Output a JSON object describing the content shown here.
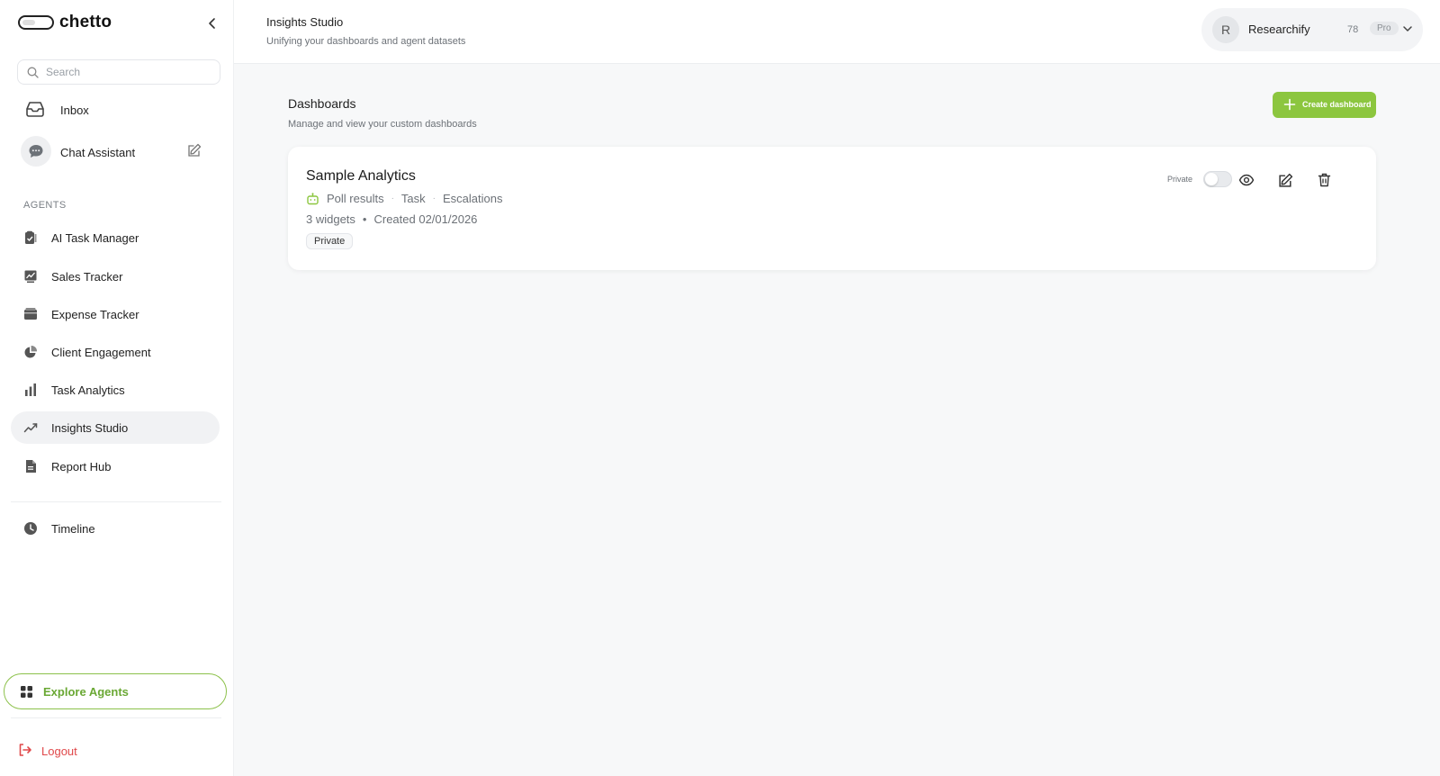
{
  "app": {
    "name": "chetto"
  },
  "sidebar": {
    "search_placeholder": "Search",
    "inbox_label": "Inbox",
    "chat_label": "Chat Assistant",
    "agents_section_label": "AGENTS",
    "agents": [
      {
        "label": "AI Task Manager",
        "icon": "task-check-icon"
      },
      {
        "label": "Sales Tracker",
        "icon": "line-chart-icon"
      },
      {
        "label": "Expense Tracker",
        "icon": "wallet-icon"
      },
      {
        "label": "Client Engagement",
        "icon": "pie-chart-icon"
      },
      {
        "label": "Task Analytics",
        "icon": "bar-chart-icon"
      },
      {
        "label": "Insights Studio",
        "icon": "trend-icon",
        "active": true
      },
      {
        "label": "Report Hub",
        "icon": "document-icon"
      }
    ],
    "timeline_label": "Timeline",
    "explore_label": "Explore Agents",
    "logout_label": "Logout"
  },
  "header": {
    "title": "Insights Studio",
    "subtitle": "Unifying your dashboards and agent datasets",
    "account": {
      "initial": "R",
      "name": "Researchify",
      "credits": "78",
      "plan": "Pro"
    }
  },
  "main": {
    "title": "Dashboards",
    "subtitle": "Manage and view your custom dashboards",
    "create_label": "Create dashboard",
    "dashboards": [
      {
        "name": "Sample Analytics",
        "sources": [
          "Poll results",
          "Task",
          "Escalations"
        ],
        "widgets": "3 widgets",
        "created": "Created 02/01/2026",
        "visibility_badge": "Private",
        "toggle_label": "Private",
        "public": false
      }
    ]
  },
  "colors": {
    "accent": "#8cc63f",
    "logout": "#e0484a",
    "active_bg": "#f1f2f4"
  }
}
